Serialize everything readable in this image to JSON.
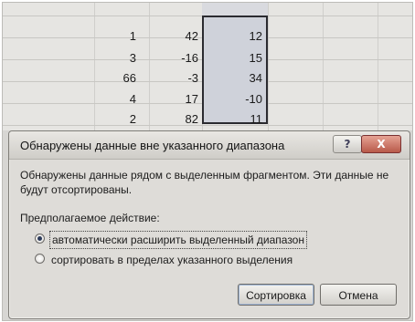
{
  "sheet": {
    "rows": [
      {
        "a": "1",
        "b": "42",
        "c": "12"
      },
      {
        "a": "3",
        "b": "-16",
        "c": "15"
      },
      {
        "a": "66",
        "b": "-3",
        "c": "34"
      },
      {
        "a": "4",
        "b": "17",
        "c": "-10"
      },
      {
        "a": "2",
        "b": "82",
        "c": "11"
      }
    ]
  },
  "dialog": {
    "title": "Обнаружены данные вне указанного диапазона",
    "help_label": "?",
    "close_label": "X",
    "message": "Обнаружены данные рядом с выделенным фрагментом. Эти данные не будут отсортированы.",
    "group_label": "Предполагаемое действие:",
    "options": [
      {
        "label": "автоматически расширить выделенный диапазон",
        "selected": true
      },
      {
        "label": "сортировать в пределах указанного выделения",
        "selected": false
      }
    ],
    "sort_button": "Сортировка",
    "cancel_button": "Отмена"
  }
}
